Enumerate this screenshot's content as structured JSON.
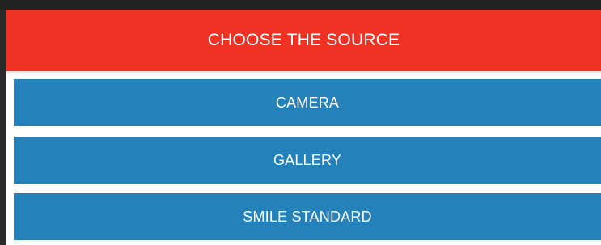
{
  "dialog": {
    "title": "CHOOSE THE SOURCE",
    "options": [
      {
        "label": "CAMERA"
      },
      {
        "label": "GALLERY"
      },
      {
        "label": "SMILE STANDARD"
      }
    ]
  },
  "colors": {
    "header_background": "#ef3224",
    "option_background": "#2581b9",
    "text": "#ffffff"
  }
}
